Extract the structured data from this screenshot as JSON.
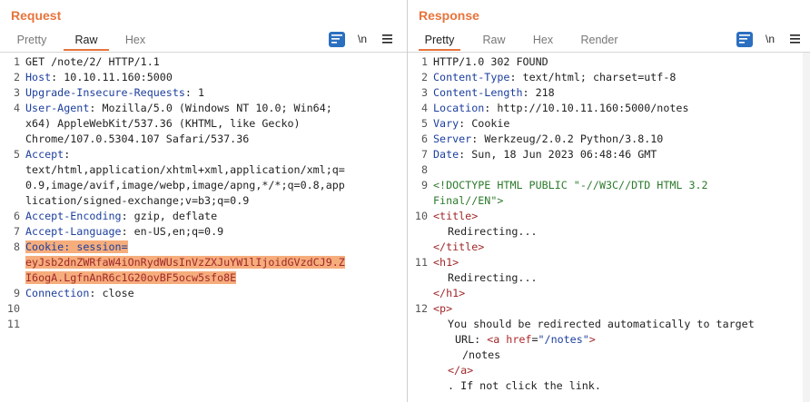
{
  "layout_toggle": {
    "icons": [
      "split-horizontal-icon",
      "split-vertical-icon",
      "single-pane-icon"
    ],
    "active": "split-horizontal-icon"
  },
  "request": {
    "title": "Request",
    "tabs": [
      {
        "label": "Pretty",
        "active": false
      },
      {
        "label": "Raw",
        "active": true
      },
      {
        "label": "Hex",
        "active": false
      }
    ],
    "toolbar": {
      "wrap_icon": "wrap-lines-icon",
      "newline_label": "\\n",
      "menu_icon": "hamburger-menu-icon"
    },
    "line_numbers": [
      "1",
      "2",
      "3",
      "4",
      "5",
      "6",
      "7",
      "8",
      "9",
      "10",
      "11"
    ],
    "lines": {
      "l1": "GET /note/2/ HTTP/1.1",
      "l2_key": "Host",
      "l2_val": " 10.10.11.160:5000",
      "l3_key": "Upgrade-Insecure-Requests",
      "l3_val": " 1",
      "l4_key": "User-Agent",
      "l4_val": " Mozilla/5.0 (Windows NT 10.0; Win64;",
      "l4_c1": "x64) AppleWebKit/537.36 (KHTML, like Gecko)",
      "l4_c2": "Chrome/107.0.5304.107 Safari/537.36",
      "l5_key": "Accept",
      "l5_c1": "text/html,application/xhtml+xml,application/xml;q=",
      "l5_c2": "0.9,image/avif,image/webp,image/apng,*/*;q=0.8,app",
      "l5_c3": "lication/signed-exchange;v=b3;q=0.9",
      "l6_key": "Accept-Encoding",
      "l6_val": " gzip, deflate",
      "l7_key": "Accept-Language",
      "l7_val": " en-US,en;q=0.9",
      "l8_key": "Cookie",
      "l8_val": " session=",
      "l8_c1": "eyJsb2dnZWRfaW4iOnRydWUsInVzZXJuYW1lIjoidGVzdCJ9.Z",
      "l8_c2": "I6ogA.LgfnAnR6c1G20ovBF5ocw5sfo8E",
      "l9_key": "Connection",
      "l9_val": " close"
    },
    "highlight_color": "#f6ad7c"
  },
  "response": {
    "title": "Response",
    "tabs": [
      {
        "label": "Pretty",
        "active": true
      },
      {
        "label": "Raw",
        "active": false
      },
      {
        "label": "Hex",
        "active": false
      },
      {
        "label": "Render",
        "active": false
      }
    ],
    "toolbar": {
      "wrap_icon": "wrap-lines-icon",
      "newline_label": "\\n",
      "menu_icon": "hamburger-menu-icon"
    },
    "line_numbers": [
      "1",
      "2",
      "3",
      "4",
      "5",
      "6",
      "7",
      "8",
      "9",
      "10",
      "11",
      "12"
    ],
    "lines": {
      "l1": "HTTP/1.0 302 FOUND",
      "l2_key": "Content-Type",
      "l2_val": " text/html; charset=utf-8",
      "l3_key": "Content-Length",
      "l3_val": " 218",
      "l4_key": "Location",
      "l4_val": " http://10.10.11.160:5000/notes",
      "l5_key": "Vary",
      "l5_val": " Cookie",
      "l6_key": "Server",
      "l6_val": " Werkzeug/2.0.2 Python/3.8.10",
      "l7_key": "Date",
      "l7_val": " Sun, 18 Jun 2023 06:48:46 GMT",
      "l9_a": "<!DOCTYPE HTML PUBLIC \"-//W3C//DTD HTML 3.2",
      "l9_b": "Final//EN\">",
      "l10_open": "<title>",
      "l10_text": "Redirecting...",
      "l10_close": "</title>",
      "l11_open": "<h1>",
      "l11_text": "Redirecting...",
      "l11_close": "</h1>",
      "l12_open": "<p>",
      "l12_text": "You should be redirected automatically to target",
      "l12_url": "URL: ",
      "l12_a_open": "<a",
      "l12_href": " href",
      "l12_eq": "=",
      "l12_hval": "\"/notes\"",
      "l12_gt": ">",
      "l12_link": "/notes",
      "l12_a_close": "</a>",
      "l12_tail": ". If not click the link."
    }
  },
  "colors": {
    "accent": "#e8743b",
    "key_blue": "#1d3f9e",
    "tag_red": "#a0282a",
    "doctype_green": "#2d7a2d",
    "button_blue": "#2b6fc0"
  }
}
